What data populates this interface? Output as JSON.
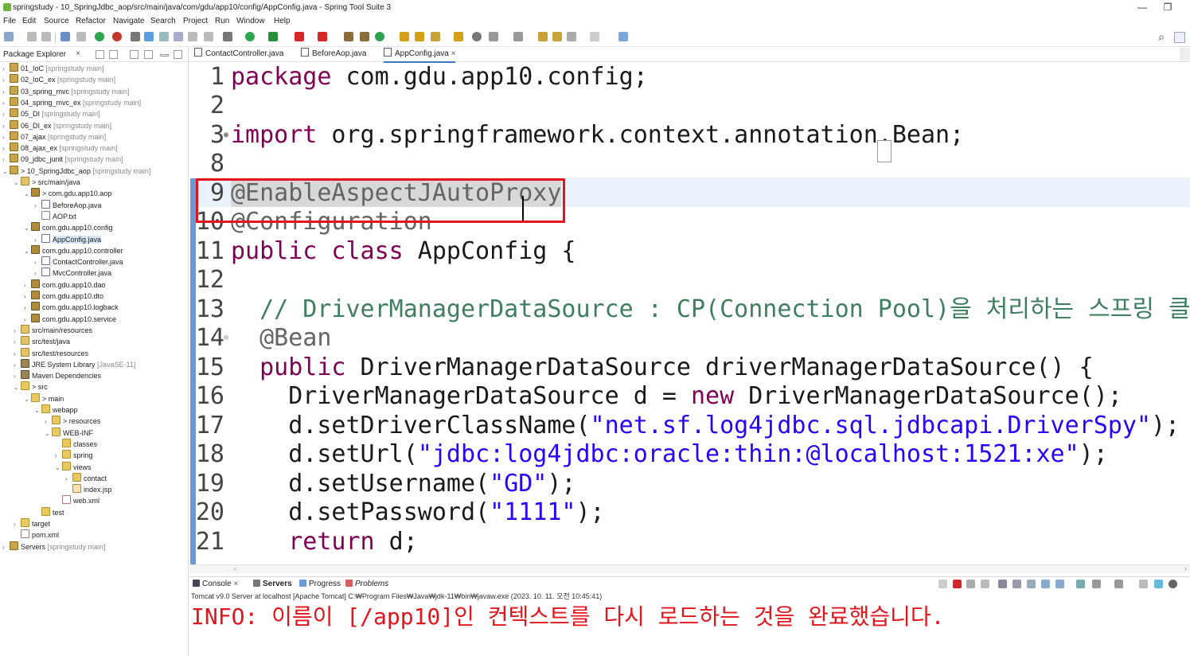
{
  "window": {
    "title": "springstudy - 10_SpringJdbc_aop/src/main/java/com/gdu/app10/config/AppConfig.java - Spring Tool Suite 3",
    "minimize": "—",
    "restore": "❐"
  },
  "menu": [
    "File",
    "Edit",
    "Source",
    "Refactor",
    "Navigate",
    "Search",
    "Project",
    "Run",
    "Window",
    "Help"
  ],
  "explorer": {
    "title": "Package Explorer",
    "close": "×",
    "items": [
      {
        "label": "01_IoC",
        "secondary": " [springstudy main]",
        "icon": "project-icon"
      },
      {
        "label": "02_IoC_ex",
        "secondary": " [springstudy main]",
        "icon": "project-icon"
      },
      {
        "label": "03_spring_mvc",
        "secondary": " [springstudy main]",
        "icon": "project-icon"
      },
      {
        "label": "04_spring_mvc_ex",
        "secondary": " [springstudy main]",
        "icon": "project-icon"
      },
      {
        "label": "05_DI",
        "secondary": " [springstudy main]",
        "icon": "project-icon"
      },
      {
        "label": "06_DI_ex",
        "secondary": " [springstudy main]",
        "icon": "project-icon"
      },
      {
        "label": "07_ajax",
        "secondary": " [springstudy main]",
        "icon": "project-icon"
      },
      {
        "label": "08_ajax_ex",
        "secondary": " [springstudy main]",
        "icon": "project-icon"
      },
      {
        "label": "09_jdbc_junit",
        "secondary": " [springstudy main]",
        "icon": "project-icon"
      },
      {
        "label": "> 10_SpringJdbc_aop",
        "secondary": " [springstudy main]",
        "icon": "project-icon"
      },
      {
        "label": "> src/main/java",
        "secondary": "",
        "icon": "source-folder-icon"
      },
      {
        "label": "> com.gdu.app10.aop",
        "secondary": "",
        "icon": "package-icon"
      },
      {
        "label": "BeforeAop.java",
        "secondary": "",
        "icon": "java-file-icon"
      },
      {
        "label": "AOP.txt",
        "secondary": "",
        "icon": "text-file-icon"
      },
      {
        "label": "com.gdu.app10.config",
        "secondary": "",
        "icon": "package-icon"
      },
      {
        "label": "AppConfig.java",
        "secondary": "",
        "icon": "java-file-icon"
      },
      {
        "label": "com.gdu.app10.controller",
        "secondary": "",
        "icon": "package-icon"
      },
      {
        "label": "ContactController.java",
        "secondary": "",
        "icon": "java-file-icon"
      },
      {
        "label": "MvcController.java",
        "secondary": "",
        "icon": "java-file-icon"
      },
      {
        "label": "com.gdu.app10.dao",
        "secondary": "",
        "icon": "package-icon"
      },
      {
        "label": "com.gdu.app10.dto",
        "secondary": "",
        "icon": "package-icon"
      },
      {
        "label": "com.gdu.app10.logback",
        "secondary": "",
        "icon": "package-icon"
      },
      {
        "label": "com.gdu.app10.service",
        "secondary": "",
        "icon": "package-icon"
      },
      {
        "label": "src/main/resources",
        "secondary": "",
        "icon": "source-folder-icon"
      },
      {
        "label": "src/test/java",
        "secondary": "",
        "icon": "source-folder-icon"
      },
      {
        "label": "src/test/resources",
        "secondary": "",
        "icon": "source-folder-icon"
      },
      {
        "label": "JRE System Library",
        "secondary": " [JavaSE-11]",
        "icon": "library-icon"
      },
      {
        "label": "Maven Dependencies",
        "secondary": "",
        "icon": "library-icon"
      },
      {
        "label": "> src",
        "secondary": "",
        "icon": "folder-icon"
      },
      {
        "label": "> main",
        "secondary": "",
        "icon": "folder-icon"
      },
      {
        "label": "webapp",
        "secondary": "",
        "icon": "folder-icon"
      },
      {
        "label": "> resources",
        "secondary": "",
        "icon": "folder-icon"
      },
      {
        "label": "WEB-INF",
        "secondary": "",
        "icon": "folder-icon"
      },
      {
        "label": "classes",
        "secondary": "",
        "icon": "folder-icon"
      },
      {
        "label": "spring",
        "secondary": "",
        "icon": "folder-icon"
      },
      {
        "label": "views",
        "secondary": "",
        "icon": "folder-icon"
      },
      {
        "label": "contact",
        "secondary": "",
        "icon": "folder-icon"
      },
      {
        "label": "index.jsp",
        "secondary": "",
        "icon": "jsp-file-icon"
      },
      {
        "label": "web.xml",
        "secondary": "",
        "icon": "xml-file-icon"
      },
      {
        "label": "test",
        "secondary": "",
        "icon": "folder-icon"
      },
      {
        "label": "target",
        "secondary": "",
        "icon": "folder-icon"
      },
      {
        "label": "pom.xml",
        "secondary": "",
        "icon": "xml-file-icon"
      },
      {
        "label": "Servers",
        "secondary": " [springstudy main]",
        "icon": "project-icon"
      }
    ]
  },
  "editor": {
    "tabs": [
      {
        "label": "ContactController.java"
      },
      {
        "label": "BeforeAop.java"
      },
      {
        "label": "AppConfig.java",
        "close": "×"
      }
    ],
    "line_numbers": [
      "1",
      "2",
      "3",
      "8",
      "9",
      "10",
      "11",
      "12",
      "13",
      "14",
      "15",
      "16",
      "17",
      "18",
      "19",
      "20",
      "21"
    ],
    "code": {
      "l1_kw": "package",
      "l1_rest": " com.gdu.app10.config;",
      "l3_kw": "import",
      "l3_rest": " org.springframework.context.annotation.Bean;",
      "l9_ann": "@EnableAspectJAutoProxy",
      "l10_ann": "@Configuration",
      "l11_kw": "public class",
      "l11_rest": " AppConfig {",
      "l13_cmt": "  // DriverManagerDataSource : CP(Connection Pool)을 처리하는 스프링 클래스",
      "l14_ann": "  @Bean",
      "l15_kw": "  public",
      "l15_rest": " DriverManagerDataSource driverManagerDataSource() {",
      "l16_a": "    DriverManagerDataSource d = ",
      "l16_kw": "new",
      "l16_b": " DriverManagerDataSource();",
      "l17_a": "    d.setDriverClassName(",
      "l17_str": "\"net.sf.log4jdbc.sql.jdbcapi.DriverSpy\"",
      "l17_b": ");",
      "l18_a": "    d.setUrl(",
      "l18_str": "\"jdbc:log4jdbc:oracle:thin:@localhost:1521:xe\"",
      "l18_b": ");",
      "l19_a": "    d.setUsername(",
      "l19_str": "\"GD\"",
      "l19_b": ");",
      "l20_a": "    d.setPassword(",
      "l20_str": "\"1111\"",
      "l20_b": ");",
      "l21_kw": "    return",
      "l21_rest": " d;"
    }
  },
  "console": {
    "tabs": [
      {
        "label": "Console"
      },
      {
        "label": "Servers"
      },
      {
        "label": "Progress"
      },
      {
        "label": "Problems"
      }
    ],
    "process": "Tomcat v9.0 Server at localhost [Apache Tomcat] C:₩Program Files₩Java₩jdk-11₩bin₩javaw.exe  (2023. 10. 11. 오전 10:45:41)",
    "output": "INFO: 이름이 [/app10]인 컨텍스트를 다시 로드하는 것을 완료했습니다."
  },
  "colors": {
    "keyword": "#7f0055",
    "string": "#2a00ff",
    "comment": "#3f7f5f",
    "annotation": "#646464",
    "highlight_box": "#e3141b",
    "console_output": "#e3141b"
  }
}
